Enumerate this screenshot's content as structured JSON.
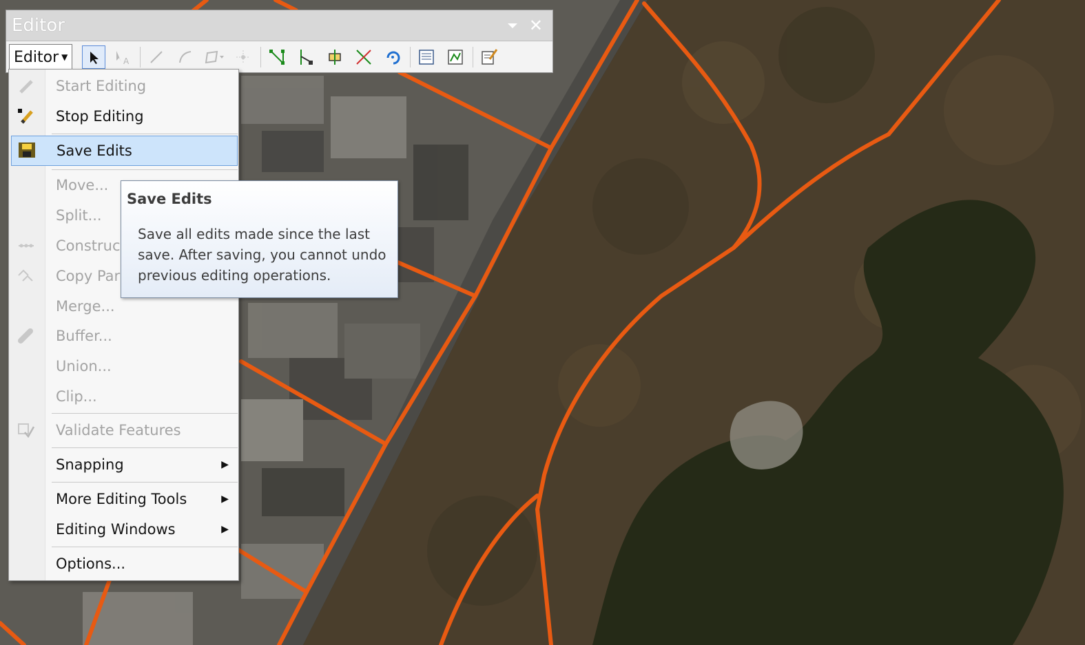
{
  "window": {
    "title": "Editor",
    "dropdown_icon": "chevron-down-icon",
    "close_icon": "close-icon"
  },
  "toolbar": {
    "editor_menu_label": "Editor",
    "tools": [
      {
        "icon": "edit-tool-arrow-icon",
        "active": true
      },
      {
        "icon": "edit-annotation-tool-icon",
        "active": false
      },
      {
        "icon": "straight-segment-icon",
        "active": false
      },
      {
        "icon": "end-point-arc-icon",
        "active": false
      },
      {
        "icon": "trace-construction-icon",
        "active": false
      },
      {
        "icon": "point-construction-icon",
        "active": false
      },
      {
        "icon": "edit-vertices-icon",
        "active": false
      },
      {
        "icon": "reshape-feature-icon",
        "active": false
      },
      {
        "icon": "cut-polygons-icon",
        "active": false
      },
      {
        "icon": "split-tool-icon",
        "active": false
      },
      {
        "icon": "rotate-tool-icon",
        "active": false
      },
      {
        "icon": "attributes-icon",
        "active": false
      },
      {
        "icon": "sketch-properties-icon",
        "active": false
      },
      {
        "icon": "create-features-icon",
        "active": false
      }
    ]
  },
  "menu": {
    "items": [
      {
        "label": "Start Editing",
        "enabled": false,
        "icon": "pencil-icon"
      },
      {
        "label": "Stop Editing",
        "enabled": true,
        "icon": "stop-pencil-icon"
      },
      {
        "label": "Save Edits",
        "enabled": true,
        "icon": "save-icon",
        "highlighted": true
      },
      {
        "label": "Move...",
        "enabled": false
      },
      {
        "label": "Split...",
        "enabled": false
      },
      {
        "label": "Construct Points...",
        "enabled": false,
        "icon": "construct-points-icon"
      },
      {
        "label": "Copy Parallel...",
        "enabled": false,
        "icon": "copy-parallel-icon"
      },
      {
        "label": "Merge...",
        "enabled": false
      },
      {
        "label": "Buffer...",
        "enabled": false,
        "icon": "buffer-icon"
      },
      {
        "label": "Union...",
        "enabled": false
      },
      {
        "label": "Clip...",
        "enabled": false
      },
      {
        "label": "Validate Features",
        "enabled": false,
        "icon": "validate-icon"
      },
      {
        "label": "Snapping",
        "enabled": true,
        "submenu": true
      },
      {
        "label": "More Editing Tools",
        "enabled": true,
        "submenu": true
      },
      {
        "label": "Editing Windows",
        "enabled": true,
        "submenu": true
      },
      {
        "label": "Options...",
        "enabled": true
      }
    ]
  },
  "tooltip": {
    "title": "Save Edits",
    "body": "Save all edits made since the last save. After saving, you cannot undo previous editing operations."
  },
  "map": {
    "line_color": "#e85a12",
    "park_color": "#4a3e2c",
    "water_color": "#252a17",
    "city_color": "#5b5a55"
  }
}
